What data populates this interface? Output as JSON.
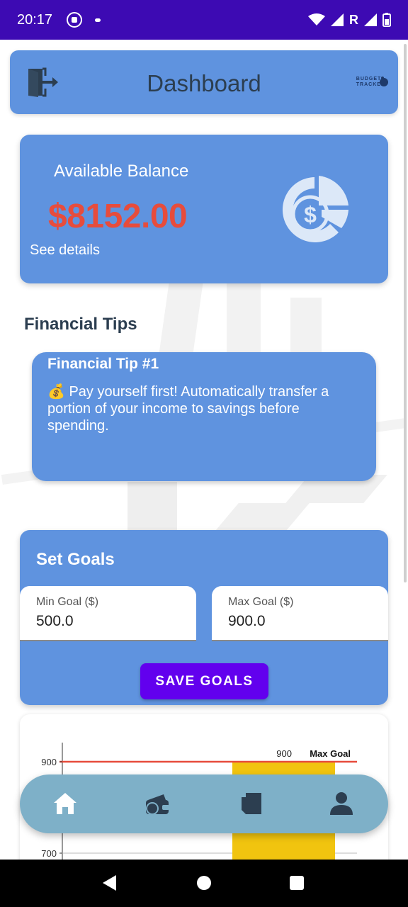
{
  "status_bar": {
    "time": "20:17",
    "carrier_indicator": "R",
    "icons": [
      "whatsapp-icon",
      "notification-dot-icon",
      "wifi-icon",
      "signal-icon",
      "battery-icon"
    ]
  },
  "header": {
    "title": "Dashboard",
    "brand_line1": "BUDGET",
    "brand_line2": "TRACKER"
  },
  "balance": {
    "label": "Available Balance",
    "amount": "$8152.00",
    "details_link": "See details"
  },
  "tips": {
    "heading": "Financial Tips",
    "items": [
      {
        "title": "Financial Tip #1",
        "body": "💰 Pay yourself first! Automatically transfer a portion of your income to savings before spending."
      }
    ]
  },
  "goals": {
    "title": "Set Goals",
    "min_label": "Min Goal ($)",
    "min_value": "500.0",
    "max_label": "Max Goal ($)",
    "max_value": "900.0",
    "save_label": "SAVE GOALS"
  },
  "chart_data": {
    "type": "bar",
    "y_ticks": [
      "900",
      "700"
    ],
    "yticks_values": [
      900,
      700
    ],
    "max_goal_line": {
      "value": 900,
      "label": "Max Goal",
      "value_label": "900"
    },
    "bars": [
      {
        "category": "",
        "value": 900
      }
    ],
    "ylim_visible": [
      680,
      930
    ]
  },
  "bottom_nav": {
    "items": [
      {
        "name": "home",
        "icon": "home-icon"
      },
      {
        "name": "wallet",
        "icon": "wallet-icon"
      },
      {
        "name": "notes",
        "icon": "note-icon"
      },
      {
        "name": "profile",
        "icon": "person-icon"
      }
    ]
  },
  "colors": {
    "status_bar": "#3d0ab3",
    "card": "#5f93df",
    "balance_amount": "#e74c3c",
    "save_button": "#6200ee",
    "nav": "#7eb0c8",
    "bar": "#f1c40f",
    "goal_line": "#e74c3c"
  }
}
